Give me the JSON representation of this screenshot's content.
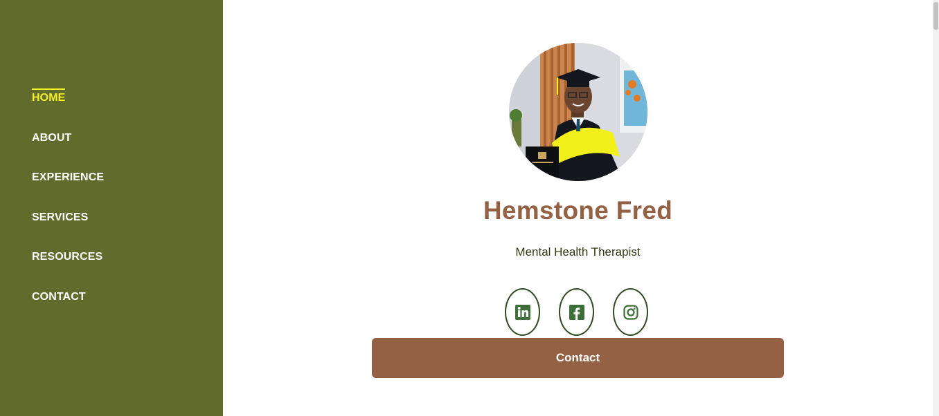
{
  "sidebar": {
    "items": [
      {
        "label": "HOME",
        "active": true
      },
      {
        "label": "ABOUT",
        "active": false
      },
      {
        "label": "EXPERIENCE",
        "active": false
      },
      {
        "label": "SERVICES",
        "active": false
      },
      {
        "label": "RESOURCES",
        "active": false
      },
      {
        "label": "CONTACT",
        "active": false
      }
    ]
  },
  "profile": {
    "name": "Hemstone Fred",
    "role": "Mental Health Therapist",
    "photo_alt": "portrait in graduation gown"
  },
  "social": [
    {
      "name": "linkedin-icon"
    },
    {
      "name": "facebook-icon"
    },
    {
      "name": "instagram-icon"
    }
  ],
  "cta": {
    "label": "Contact"
  },
  "colors": {
    "sidebar_bg": "#606b2c",
    "active_nav": "#f6ee2a",
    "name_color": "#956144",
    "button_bg": "#956144",
    "icon_color": "#3d6e3a"
  }
}
